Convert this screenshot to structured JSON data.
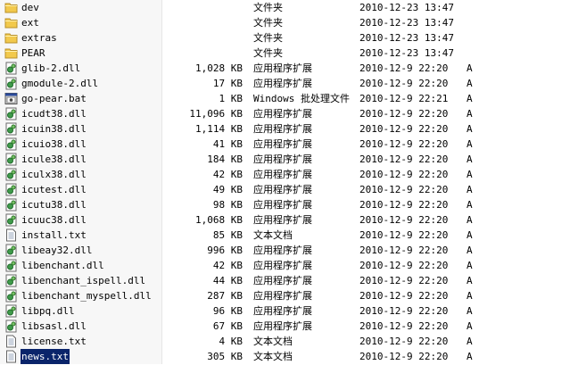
{
  "files": [
    {
      "name": "dev",
      "size": "",
      "type": "文件夹",
      "modified": "2010-12-23 13:47",
      "attr": "",
      "icon": "folder-icon"
    },
    {
      "name": "ext",
      "size": "",
      "type": "文件夹",
      "modified": "2010-12-23 13:47",
      "attr": "",
      "icon": "folder-icon"
    },
    {
      "name": "extras",
      "size": "",
      "type": "文件夹",
      "modified": "2010-12-23 13:47",
      "attr": "",
      "icon": "folder-icon"
    },
    {
      "name": "PEAR",
      "size": "",
      "type": "文件夹",
      "modified": "2010-12-23 13:47",
      "attr": "",
      "icon": "folder-icon"
    },
    {
      "name": "glib-2.dll",
      "size": "1,028 KB",
      "type": "应用程序扩展",
      "modified": "2010-12-9 22:20",
      "attr": "A",
      "icon": "dll-icon"
    },
    {
      "name": "gmodule-2.dll",
      "size": "17 KB",
      "type": "应用程序扩展",
      "modified": "2010-12-9 22:20",
      "attr": "A",
      "icon": "dll-icon"
    },
    {
      "name": "go-pear.bat",
      "size": "1 KB",
      "type": "Windows 批处理文件",
      "modified": "2010-12-9 22:21",
      "attr": "A",
      "icon": "bat-icon"
    },
    {
      "name": "icudt38.dll",
      "size": "11,096 KB",
      "type": "应用程序扩展",
      "modified": "2010-12-9 22:20",
      "attr": "A",
      "icon": "dll-icon"
    },
    {
      "name": "icuin38.dll",
      "size": "1,114 KB",
      "type": "应用程序扩展",
      "modified": "2010-12-9 22:20",
      "attr": "A",
      "icon": "dll-icon"
    },
    {
      "name": "icuio38.dll",
      "size": "41 KB",
      "type": "应用程序扩展",
      "modified": "2010-12-9 22:20",
      "attr": "A",
      "icon": "dll-icon"
    },
    {
      "name": "icule38.dll",
      "size": "184 KB",
      "type": "应用程序扩展",
      "modified": "2010-12-9 22:20",
      "attr": "A",
      "icon": "dll-icon"
    },
    {
      "name": "iculx38.dll",
      "size": "42 KB",
      "type": "应用程序扩展",
      "modified": "2010-12-9 22:20",
      "attr": "A",
      "icon": "dll-icon"
    },
    {
      "name": "icutest.dll",
      "size": "49 KB",
      "type": "应用程序扩展",
      "modified": "2010-12-9 22:20",
      "attr": "A",
      "icon": "dll-icon"
    },
    {
      "name": "icutu38.dll",
      "size": "98 KB",
      "type": "应用程序扩展",
      "modified": "2010-12-9 22:20",
      "attr": "A",
      "icon": "dll-icon"
    },
    {
      "name": "icuuc38.dll",
      "size": "1,068 KB",
      "type": "应用程序扩展",
      "modified": "2010-12-9 22:20",
      "attr": "A",
      "icon": "dll-icon"
    },
    {
      "name": "install.txt",
      "size": "85 KB",
      "type": "文本文档",
      "modified": "2010-12-9 22:20",
      "attr": "A",
      "icon": "text-file-icon"
    },
    {
      "name": "libeay32.dll",
      "size": "996 KB",
      "type": "应用程序扩展",
      "modified": "2010-12-9 22:20",
      "attr": "A",
      "icon": "dll-icon"
    },
    {
      "name": "libenchant.dll",
      "size": "42 KB",
      "type": "应用程序扩展",
      "modified": "2010-12-9 22:20",
      "attr": "A",
      "icon": "dll-icon"
    },
    {
      "name": "libenchant_ispell.dll",
      "size": "44 KB",
      "type": "应用程序扩展",
      "modified": "2010-12-9 22:20",
      "attr": "A",
      "icon": "dll-icon"
    },
    {
      "name": "libenchant_myspell.dll",
      "size": "287 KB",
      "type": "应用程序扩展",
      "modified": "2010-12-9 22:20",
      "attr": "A",
      "icon": "dll-icon"
    },
    {
      "name": "libpq.dll",
      "size": "96 KB",
      "type": "应用程序扩展",
      "modified": "2010-12-9 22:20",
      "attr": "A",
      "icon": "dll-icon"
    },
    {
      "name": "libsasl.dll",
      "size": "67 KB",
      "type": "应用程序扩展",
      "modified": "2010-12-9 22:20",
      "attr": "A",
      "icon": "dll-icon"
    },
    {
      "name": "license.txt",
      "size": "4 KB",
      "type": "文本文档",
      "modified": "2010-12-9 22:20",
      "attr": "A",
      "icon": "text-file-icon"
    },
    {
      "name": "news.txt",
      "size": "305 KB",
      "type": "文本文档",
      "modified": "2010-12-9 22:20",
      "attr": "A",
      "icon": "text-file-icon",
      "selected": true
    }
  ],
  "colors": {
    "selection": "#0a246a",
    "folder": "#f2c94c",
    "dll": "#3f9b4a"
  }
}
